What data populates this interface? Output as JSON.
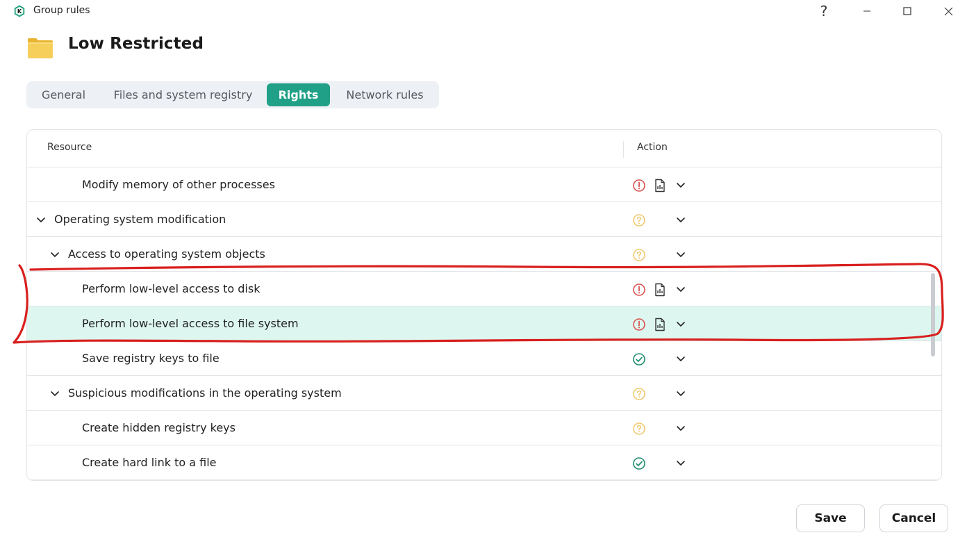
{
  "window": {
    "title": "Group rules",
    "help_label": "?",
    "colors": {
      "brand": "#1fa27f"
    }
  },
  "header": {
    "title": "Low Restricted",
    "icon": "folder-icon"
  },
  "tabs": [
    {
      "label": "General",
      "active": false
    },
    {
      "label": "Files and system registry",
      "active": false
    },
    {
      "label": "Rights",
      "active": true
    },
    {
      "label": "Network rules",
      "active": false
    }
  ],
  "table": {
    "columns": {
      "resource": "Resource",
      "action": "Action"
    },
    "rows": [
      {
        "label": "Modify memory of other processes",
        "level": 2,
        "expandable": false,
        "status": "deny",
        "report": true,
        "selected": false
      },
      {
        "label": "Operating system modification",
        "level": 0,
        "expandable": true,
        "status": "ask",
        "report": false,
        "selected": false
      },
      {
        "label": "Access to operating system objects",
        "level": 1,
        "expandable": true,
        "status": "ask",
        "report": false,
        "selected": false
      },
      {
        "label": "Perform low-level access to disk",
        "level": 2,
        "expandable": false,
        "status": "deny",
        "report": true,
        "selected": false
      },
      {
        "label": "Perform low-level access to file system",
        "level": 2,
        "expandable": false,
        "status": "deny",
        "report": true,
        "selected": true
      },
      {
        "label": "Save registry keys to file",
        "level": 2,
        "expandable": false,
        "status": "allow",
        "report": false,
        "selected": false
      },
      {
        "label": "Suspicious modifications in the operating system",
        "level": 1,
        "expandable": true,
        "status": "ask",
        "report": false,
        "selected": false
      },
      {
        "label": "Create hidden registry keys",
        "level": 2,
        "expandable": false,
        "status": "ask",
        "report": false,
        "selected": false
      },
      {
        "label": "Create hard link to a file",
        "level": 2,
        "expandable": false,
        "status": "allow",
        "report": false,
        "selected": false
      }
    ],
    "status_colors": {
      "deny": "#d9534f",
      "ask": "#f0c870",
      "allow": "#1f8c6e"
    }
  },
  "footer": {
    "save_label": "Save",
    "cancel_label": "Cancel"
  }
}
